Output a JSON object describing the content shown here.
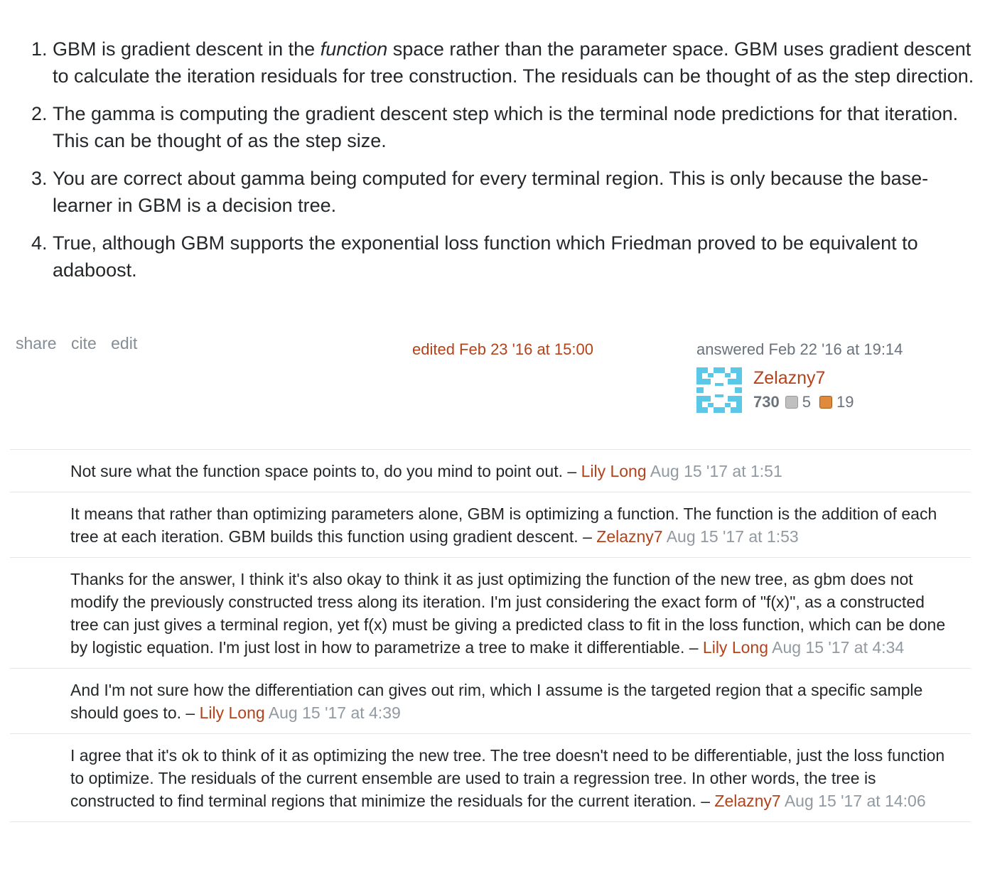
{
  "answer": {
    "items": [
      {
        "before": "GBM is gradient descent in the ",
        "italic": "function",
        "after": " space rather than the parameter space. GBM uses gradient descent to calculate the iteration residuals for tree construction. The residuals can be thought of as the step direction."
      },
      {
        "text": "The gamma is computing the gradient descent step which is the terminal node predictions for that iteration. This can be thought of as the step size."
      },
      {
        "text": "You are correct about gamma being computed for every terminal region. This is only because the base-learner in GBM is a decision tree."
      },
      {
        "text": "True, although GBM supports the exponential loss function which Friedman proved to be equivalent to adaboost."
      }
    ]
  },
  "post_menu": {
    "share": "share",
    "cite": "cite",
    "edit": "edit"
  },
  "edited": "edited Feb 23 '16 at 15:00",
  "user": {
    "action_time": "answered Feb 22 '16 at 19:14",
    "name": "Zelazny7",
    "reputation": "730",
    "silver_badges": "5",
    "bronze_badges": "19",
    "colors": {
      "link": "#b4421a",
      "avatar": "#5bc8e8"
    }
  },
  "comments": [
    {
      "text": "Not sure what the function space points to, do you mind to point out.",
      "user": "Lily Long",
      "date": "Aug 15 '17 at 1:51"
    },
    {
      "text": "It means that rather than optimizing parameters alone, GBM is optimizing a function. The function is the addition of each tree at each iteration. GBM builds this function using gradient descent.",
      "user": "Zelazny7",
      "date": "Aug 15 '17 at 1:53"
    },
    {
      "text": "Thanks for the answer, I think it's also okay to think it as just optimizing the function of the new tree, as gbm does not modify the previously constructed tress along its iteration. I'm just considering the exact form of \"f(x)\", as a constructed tree can just gives a terminal region, yet f(x) must be giving a predicted class to fit in the loss function, which can be done by logistic equation. I'm just lost in how to parametrize a tree to make it differentiable.",
      "user": "Lily Long",
      "date": "Aug 15 '17 at 4:34"
    },
    {
      "text": "And I'm not sure how the differentiation can gives out rim, which I assume is the targeted region that a specific sample should goes to.",
      "user": "Lily Long",
      "date": "Aug 15 '17 at 4:39"
    },
    {
      "text": "I agree that it's ok to think of it as optimizing the new tree. The tree doesn't need to be differentiable, just the loss function to optimize. The residuals of the current ensemble are used to train a regression tree. In other words, the tree is constructed to find terminal regions that minimize the residuals for the current iteration.",
      "user": "Zelazny7",
      "date": "Aug 15 '17 at 14:06"
    }
  ]
}
